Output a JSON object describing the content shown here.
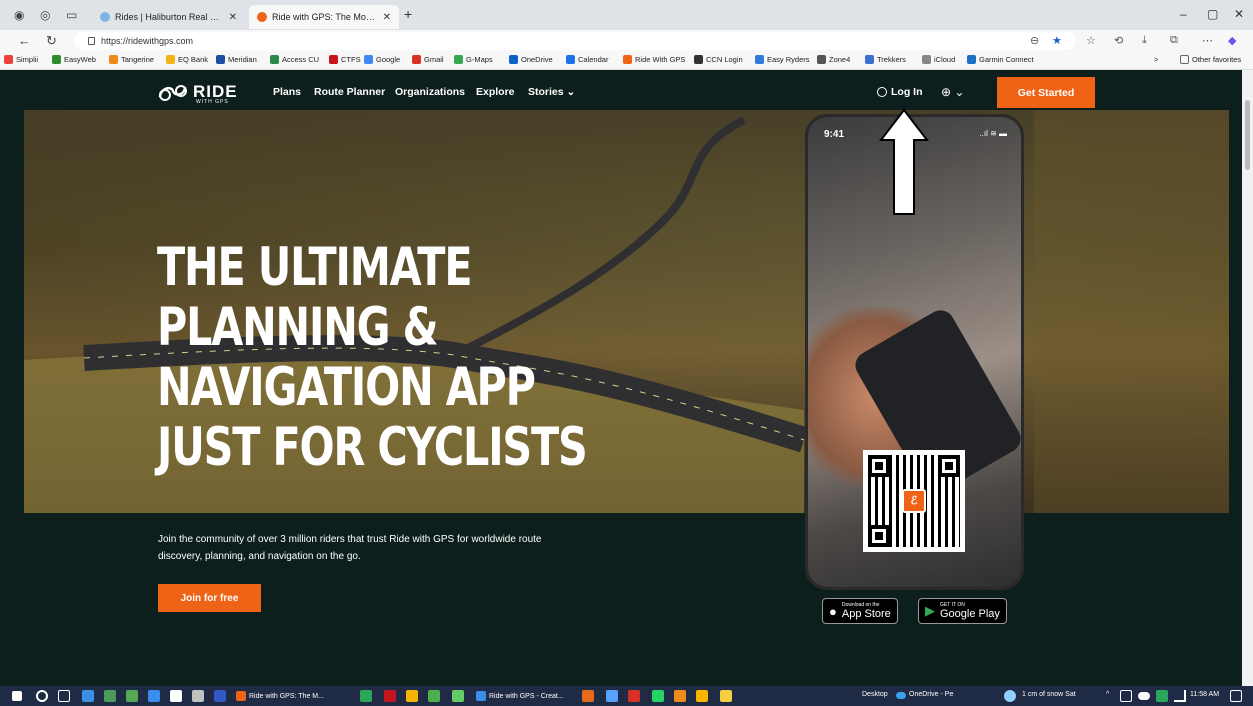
{
  "browser": {
    "tabs": [
      {
        "title": "Rides | Haliburton Real Easy Ryde",
        "active": false
      },
      {
        "title": "Ride with GPS: The Most Trusted",
        "active": true
      }
    ],
    "new_tab": "+",
    "url": "https://ridewithgps.com",
    "window_controls": {
      "minimize": "–",
      "restore": "▢",
      "close": "✕"
    },
    "bookmarks": [
      {
        "label": "Simplii",
        "color": "#e8423a"
      },
      {
        "label": "EasyWeb",
        "color": "#2e8b2e"
      },
      {
        "label": "Tangerine",
        "color": "#f08a1c"
      },
      {
        "label": "EQ Bank",
        "color": "#f2b317"
      },
      {
        "label": "Meridian",
        "color": "#1b4fa3"
      },
      {
        "label": "Access CU",
        "color": "#2a8a4a"
      },
      {
        "label": "CTFS",
        "color": "#c4161c"
      },
      {
        "label": "Google",
        "color": "#4285f4"
      },
      {
        "label": "Gmail",
        "color": "#d93025"
      },
      {
        "label": "G-Maps",
        "color": "#34a853"
      },
      {
        "label": "OneDrive",
        "color": "#0a64c8"
      },
      {
        "label": "Calendar",
        "color": "#1a73e8"
      },
      {
        "label": "Ride With GPS",
        "color": "#ef6316"
      },
      {
        "label": "CCN Login",
        "color": "#333333"
      },
      {
        "label": "Easy Ryders",
        "color": "#2f7ad8"
      },
      {
        "label": "Zone4",
        "color": "#555555"
      },
      {
        "label": "Trekkers",
        "color": "#3d6fd1"
      },
      {
        "label": "iCloud",
        "color": "#888888"
      },
      {
        "label": "Garmin Connect",
        "color": "#1d6ec7"
      }
    ],
    "other_favorites": "Other favorites"
  },
  "site": {
    "logo_word": "RIDE",
    "logo_sub": "WITH GPS",
    "nav": [
      "Plans",
      "Route Planner",
      "Organizations",
      "Explore",
      "Stories ⌄"
    ],
    "login": "Log In",
    "lang": "⊕ ⌄",
    "get_started": "Get Started",
    "headline": [
      "THE ULTIMATE",
      "PLANNING &",
      "NAVIGATION APP",
      "JUST FOR CYCLISTS"
    ],
    "subcopy": "Join the community of over 3 million riders that trust Ride with GPS for worldwide route discovery, planning, and navigation on the go.",
    "join_button": "Join for free",
    "phone_time": "9:41",
    "phone_status": "..ıl ≋ ▬",
    "app_store": {
      "small": "Download on the",
      "big": "App Store"
    },
    "google_play": {
      "small": "GET IT ON",
      "big": "Google Play"
    },
    "accent": "#ef6316"
  },
  "taskbar": {
    "apps": [
      "Ride with GPS: The M...",
      "Ride with GPS - Creat..."
    ],
    "desktop": "Desktop",
    "onedrive": "OneDrive - Pe",
    "weather": "1 cm of snow Sat",
    "time": "11:58 AM"
  }
}
